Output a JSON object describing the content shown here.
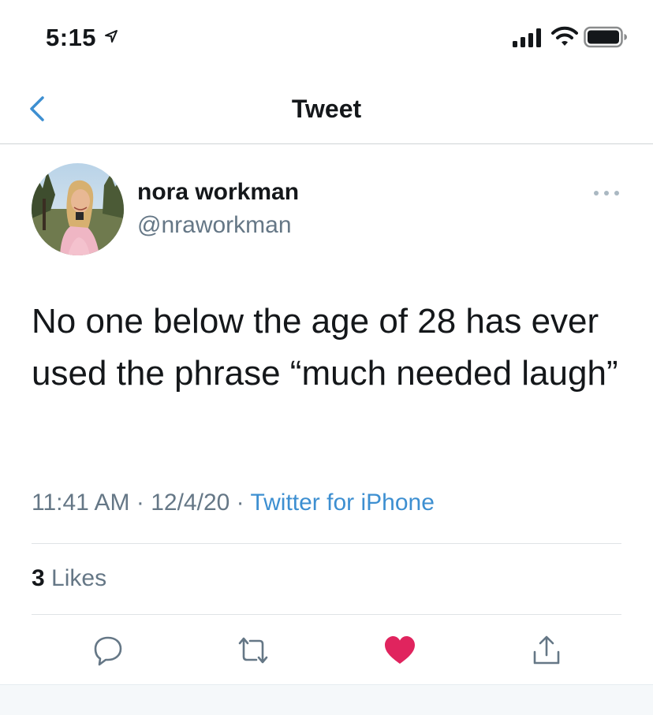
{
  "status_bar": {
    "time": "5:15",
    "icons": [
      "location-arrow-icon",
      "signal-icon",
      "wifi-icon",
      "battery-icon"
    ]
  },
  "nav": {
    "title": "Tweet",
    "back_icon": "chevron-left-icon"
  },
  "tweet": {
    "author": {
      "display_name": "nora workman",
      "handle": "@nraworkman",
      "avatar_icon": "user-avatar"
    },
    "more_icon": "more-horizontal-icon",
    "text": "No one below the age of 28 has ever used the phrase “much needed laugh”",
    "meta": {
      "time": "11:41 AM",
      "separator": "·",
      "date": "12/4/20",
      "source": "Twitter for iPhone"
    },
    "likes": {
      "count": "3",
      "label": "Likes"
    }
  },
  "actions": [
    {
      "name": "reply",
      "icon": "reply-icon"
    },
    {
      "name": "retweet",
      "icon": "retweet-icon"
    },
    {
      "name": "like",
      "icon": "heart-icon",
      "active": true
    },
    {
      "name": "share",
      "icon": "share-icon"
    }
  ],
  "colors": {
    "accent": "#3d8fd1",
    "secondary_text": "#657786",
    "primary_text": "#14171a",
    "like_active": "#e0245e"
  }
}
